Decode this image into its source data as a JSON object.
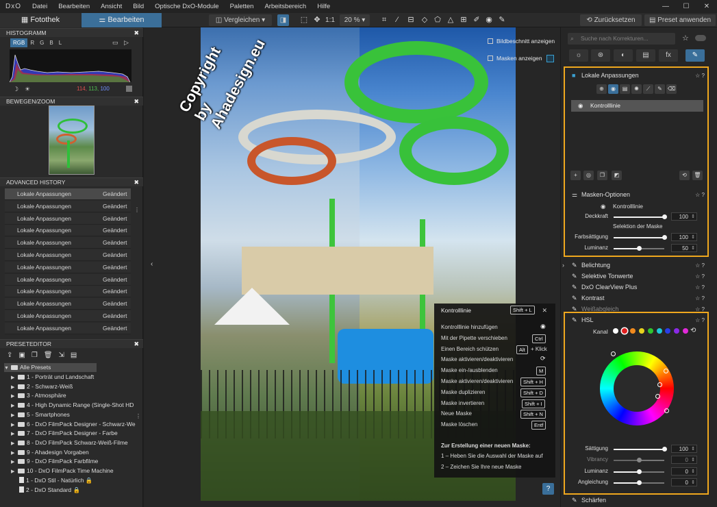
{
  "app": {
    "logo": "DxO"
  },
  "menu": [
    "Datei",
    "Bearbeiten",
    "Ansicht",
    "Bild",
    "Optische DxO-Module",
    "Paletten",
    "Arbeitsbereich",
    "Hilfe"
  ],
  "toolbar": {
    "tab_library": "Fotothek",
    "tab_edit": "Bearbeiten",
    "compare": "Vergleichen",
    "ratio": "1:1",
    "zoom": "20 %",
    "reset": "Zurücksetzen",
    "apply_preset": "Preset anwenden"
  },
  "histogram": {
    "title": "HISTOGRAMM",
    "channels": [
      "RGB",
      "R",
      "G",
      "B",
      "L"
    ],
    "active_channel": "RGB",
    "values": {
      "r": "114,",
      "g": "113,",
      "b": "100"
    }
  },
  "navigator": {
    "title": "BEWEGEN/ZOOM"
  },
  "history": {
    "title": "ADVANCED HISTORY",
    "rows": [
      {
        "name": "Lokale Anpassungen",
        "status": "Geändert"
      },
      {
        "name": "Lokale Anpassungen",
        "status": "Geändert"
      },
      {
        "name": "Lokale Anpassungen",
        "status": "Geändert"
      },
      {
        "name": "Lokale Anpassungen",
        "status": "Geändert"
      },
      {
        "name": "Lokale Anpassungen",
        "status": "Geändert"
      },
      {
        "name": "Lokale Anpassungen",
        "status": "Geändert"
      },
      {
        "name": "Lokale Anpassungen",
        "status": "Geändert"
      },
      {
        "name": "Lokale Anpassungen",
        "status": "Geändert"
      },
      {
        "name": "Lokale Anpassungen",
        "status": "Geändert"
      },
      {
        "name": "Lokale Anpassungen",
        "status": "Geändert"
      },
      {
        "name": "Lokale Anpassungen",
        "status": "Geändert"
      },
      {
        "name": "Lokale Anpassungen",
        "status": "Geändert"
      }
    ]
  },
  "preset_editor": {
    "title": "PRESETEDITOR",
    "root": "Alle Presets",
    "folders": [
      "1 - Porträt und Landschaft",
      "2 - Schwarz-Weiß",
      "3 - Atmosphäre",
      "4 - High Dynamic Range (Single-Shot HD",
      "5 - Smartphones",
      "6 - DxO FilmPack Designer - Schwarz-We",
      "7 - DxO FilmPack Designer - Farbe",
      "8 - DxO FilmPack Schwarz-Weiß-Filme",
      "9 - Ahadesign Vorgaben",
      "9 - DxO FilmPack Farbfilme",
      "10 - DxO FilmPack Time Machine"
    ],
    "files": [
      "1 - DxO Stil - Natürlich",
      "2 - DxO Standard"
    ]
  },
  "viewer": {
    "show_crop": "Bildbeschnitt anzeigen",
    "show_masks": "Masken anzeigen",
    "watermark": "Copyright by Ahadesign.eu"
  },
  "popup": {
    "title": "Kontrolllinie",
    "title_key": "Shift + L",
    "rows": [
      {
        "label": "Kontrolllinie hinzufügen",
        "key": ""
      },
      {
        "label": "Mit der Pipette verschieben",
        "key": "Ctrl"
      },
      {
        "label": "Einen Bereich schützen",
        "key": "Alt",
        "extra": "+ Klick"
      },
      {
        "label": "Maske aktivieren/deaktivieren",
        "key": ""
      },
      {
        "label": "Maske ein-/ausblenden",
        "key": "M"
      },
      {
        "label": "Maske aktivieren/deaktivieren",
        "key": "Shift + H"
      },
      {
        "label": "Maske duplizieren",
        "key": "Shift + D"
      },
      {
        "label": "Maske invertieren",
        "key": "Shift + I"
      },
      {
        "label": "Neue Maske",
        "key": "Shift + N"
      },
      {
        "label": "Maske löschen",
        "key": "Entf"
      }
    ],
    "howto_title": "Zur Erstellung einer neuen Maske:",
    "step1": "1 – Heben Sie die Auswahl der Maske auf",
    "step2": "2 – Zeichen Sie Ihre neue Maske",
    "help": "?"
  },
  "right": {
    "search_placeholder": "Suche nach Korrekturen...",
    "tabs": [
      "☼",
      "⊛",
      "◐",
      "▤",
      "fx",
      "✎"
    ],
    "local": {
      "title": "Lokale Anpassungen",
      "mask_item": "Kontrolllinie"
    },
    "mask_options": {
      "title": "Masken-Optionen",
      "type": "Kontrolllinie",
      "opacity_label": "Deckkraft",
      "opacity": "100",
      "selection_label": "Selektion der Maske",
      "saturation_label": "Farbsättigung",
      "saturation": "100",
      "luminance_label": "Luminanz",
      "luminance": "50",
      "opacity_level": 1.0,
      "saturation_level": 1.0,
      "luminance_level": 0.5
    },
    "sections": [
      "Belichtung",
      "Selektive Tonwerte",
      "DxO ClearView Plus",
      "Kontrast",
      "Weißabgleich"
    ],
    "hsl": {
      "title": "HSL",
      "channel_label": "Kanal",
      "swatch_colors": [
        "#ffffff",
        "#e02020",
        "#f08a1e",
        "#e6d21e",
        "#2fc42f",
        "#1ec8d8",
        "#2a3ee6",
        "#8a2ae6",
        "#e02ad8"
      ],
      "saturation_label": "Sättigung",
      "saturation": "100",
      "vibrancy_label": "Vibrancy",
      "vibrancy": "0",
      "luminance_label": "Luminanz",
      "luminance": "0",
      "uniformity_label": "Angleichung",
      "uniformity": "0"
    },
    "bottom_section": "Schärfen"
  }
}
